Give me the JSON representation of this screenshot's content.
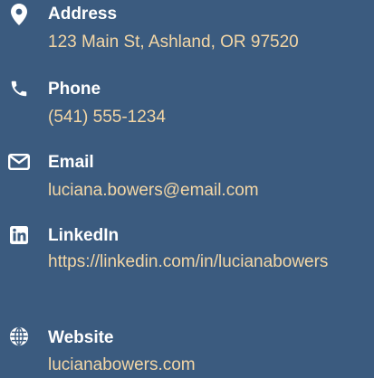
{
  "theme": {
    "background": "#3b5b7f",
    "label_color": "#ffffff",
    "value_color": "#f4d7a6"
  },
  "contacts": [
    {
      "icon": "map-marker-icon",
      "label": "Address",
      "value": "123 Main St, Ashland, OR 97520"
    },
    {
      "icon": "phone-icon",
      "label": "Phone",
      "value": "(541) 555-1234"
    },
    {
      "icon": "envelope-icon",
      "label": "Email",
      "value": "luciana.bowers@email.com"
    },
    {
      "icon": "linkedin-icon",
      "label": "LinkedIn",
      "value": "https://linkedin.com/in/lucianabowers"
    },
    {
      "icon": "globe-icon",
      "label": "Website",
      "value": "lucianabowers.com"
    }
  ]
}
